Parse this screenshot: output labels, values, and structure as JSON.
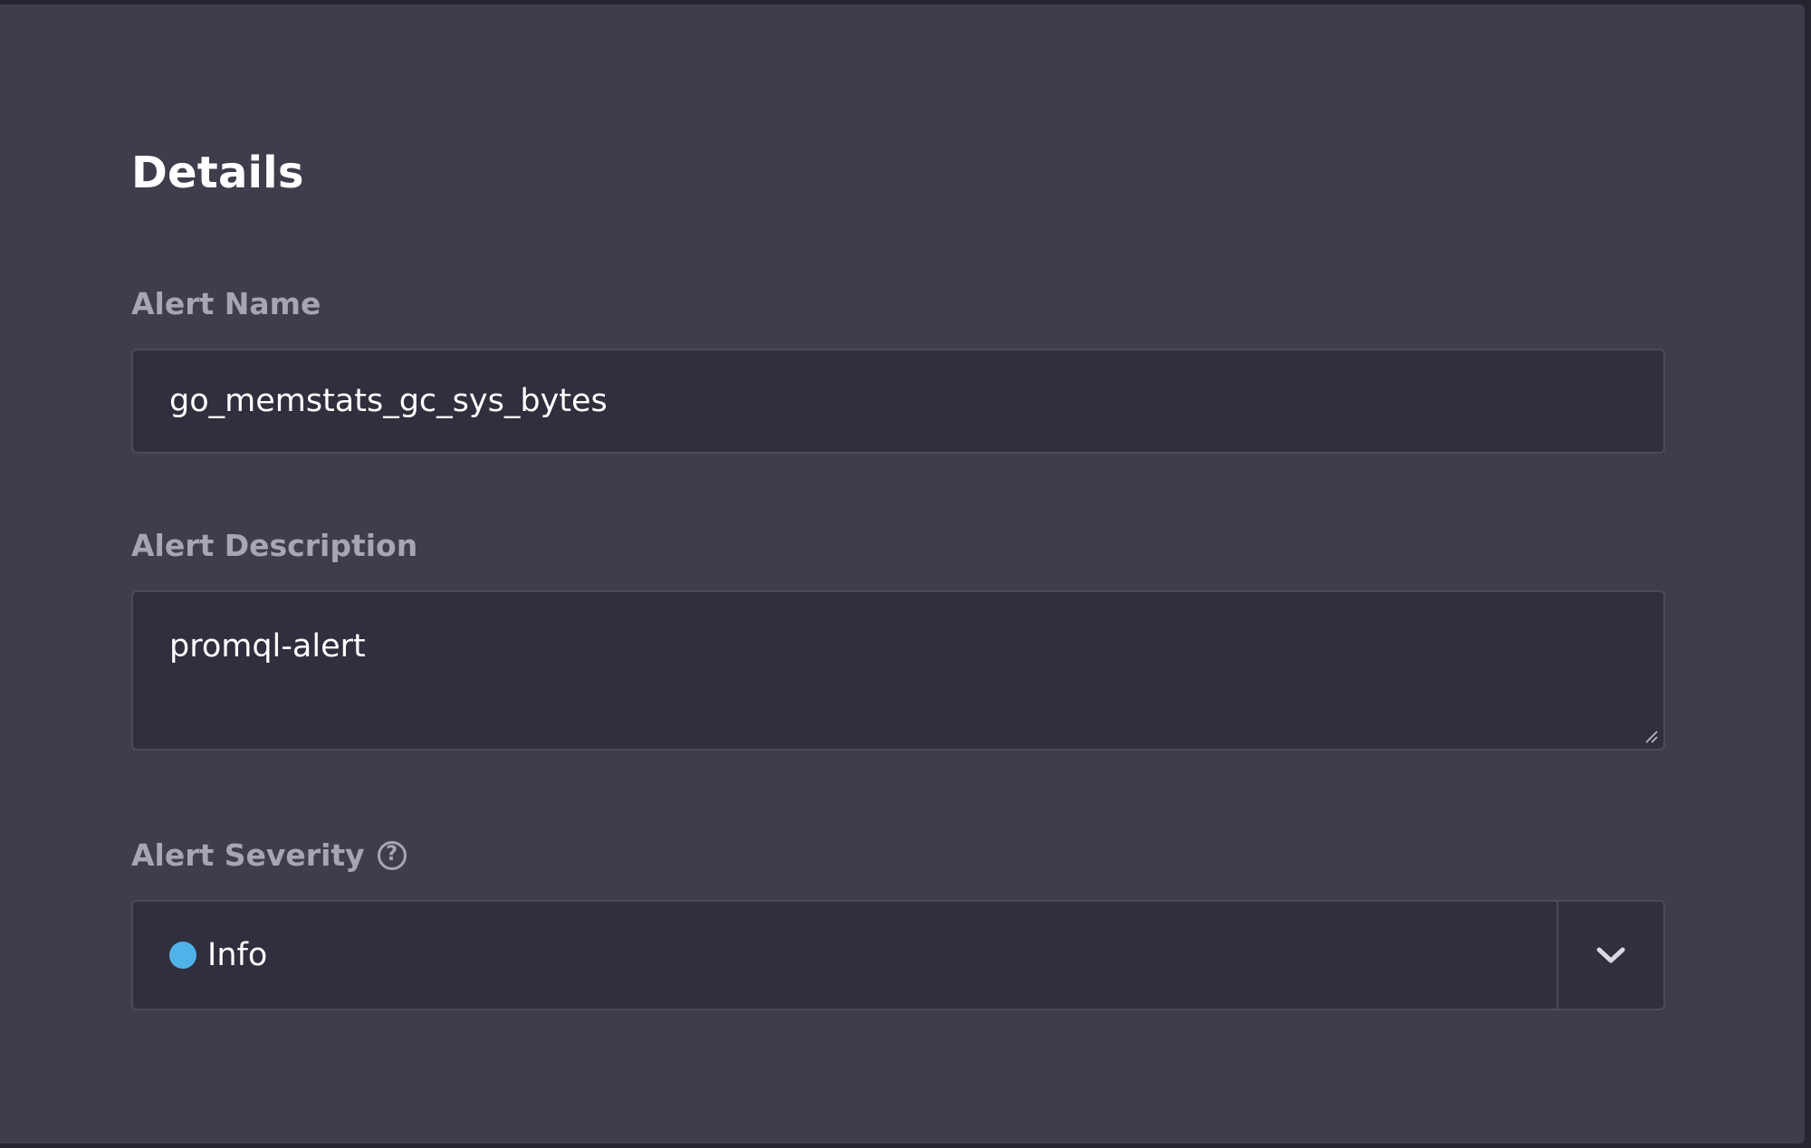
{
  "details": {
    "title": "Details",
    "alert_name": {
      "label": "Alert Name",
      "value": "go_memstats_gc_sys_bytes"
    },
    "alert_description": {
      "label": "Alert Description",
      "value": "promql-alert"
    },
    "alert_severity": {
      "label": "Alert Severity",
      "help_icon": "question-circle-icon",
      "selected": "Info",
      "selected_color": "#4fb3ea",
      "toggle_icon": "chevron-down-icon"
    }
  }
}
